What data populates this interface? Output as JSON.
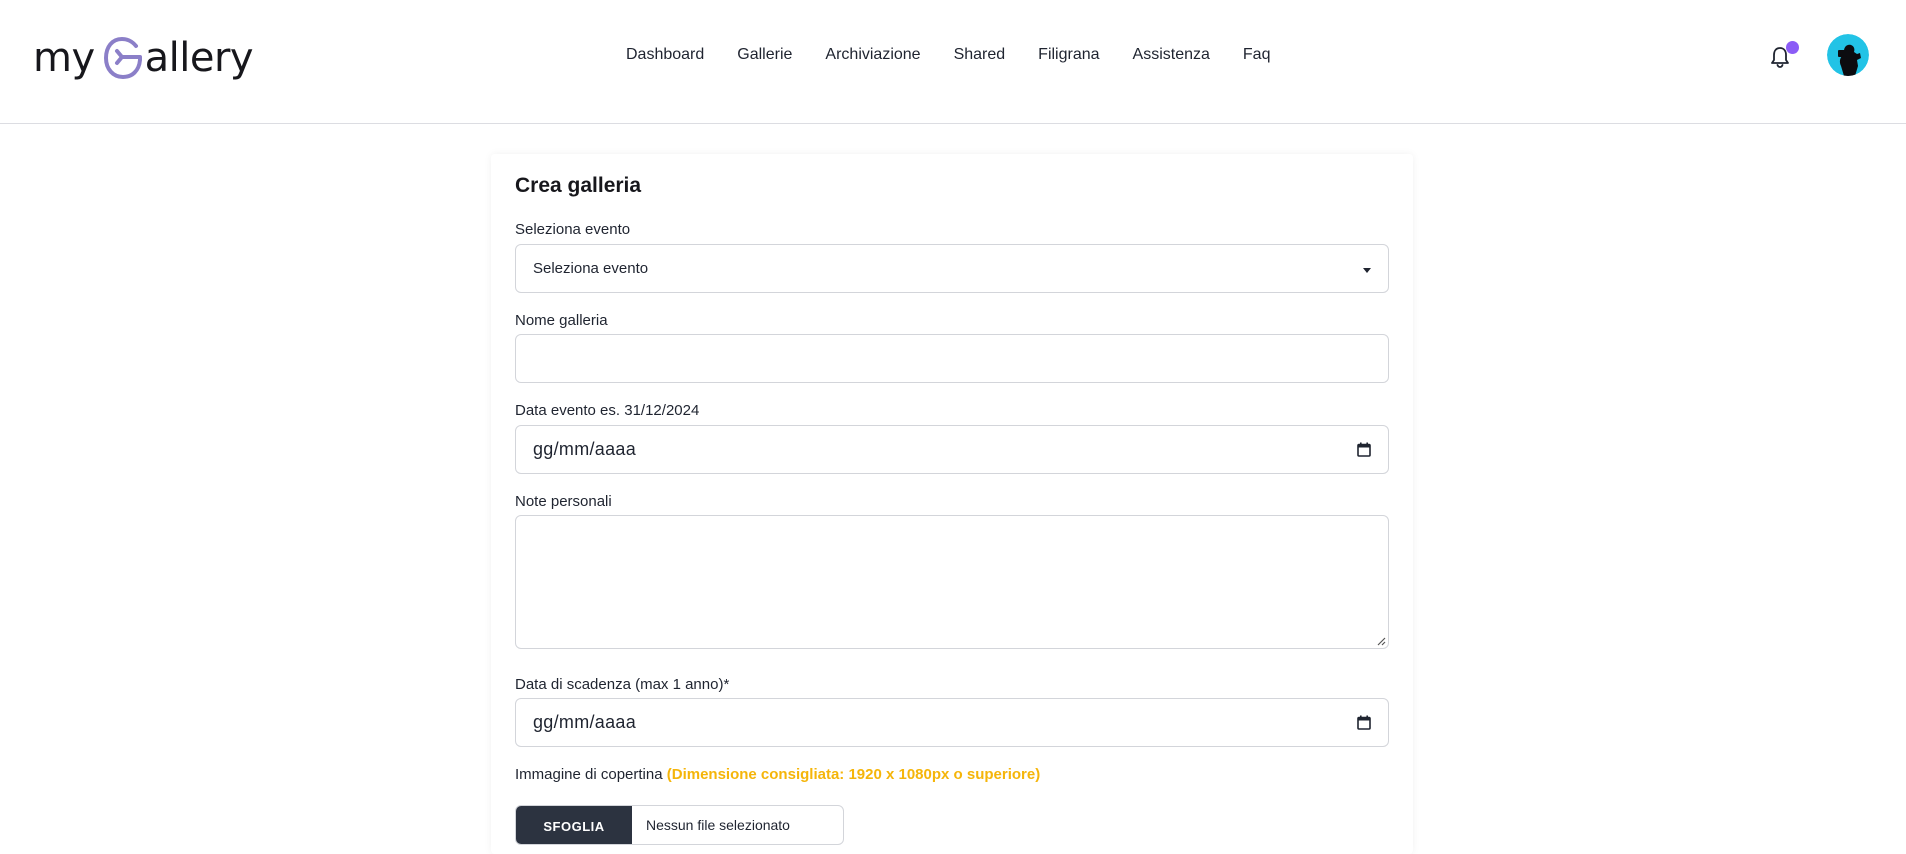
{
  "brand": {
    "logo_prefix": "my",
    "logo_suffix": "allery",
    "accent_color": "#8b7fc8"
  },
  "nav": {
    "items": [
      {
        "label": "Dashboard"
      },
      {
        "label": "Gallerie"
      },
      {
        "label": "Archiviazione"
      },
      {
        "label": "Shared"
      },
      {
        "label": "Filigrana"
      },
      {
        "label": "Assistenza"
      },
      {
        "label": "Faq"
      }
    ],
    "notification_icon": "bell-icon",
    "notification_dot_color": "#8b5cf6",
    "avatar_icon": "user-avatar"
  },
  "form": {
    "title": "Crea galleria",
    "event": {
      "label": "Seleziona evento",
      "selected": "Seleziona evento"
    },
    "gallery_name": {
      "label": "Nome galleria",
      "value": ""
    },
    "event_date": {
      "label": "Data evento es. 31/12/2024",
      "placeholder": "gg/mm/aaaa"
    },
    "notes": {
      "label": "Note personali",
      "value": ""
    },
    "expiry_date": {
      "label": "Data di scadenza (max 1 anno)*",
      "placeholder": "gg/mm/aaaa"
    },
    "cover": {
      "label": "Immagine di copertina",
      "hint": "(Dimensione consigliata: 1920 x 1080px o superiore)",
      "hint_color": "#f5b50a",
      "button_label": "SFOGLIA",
      "file_status": "Nessun file selezionato"
    }
  }
}
